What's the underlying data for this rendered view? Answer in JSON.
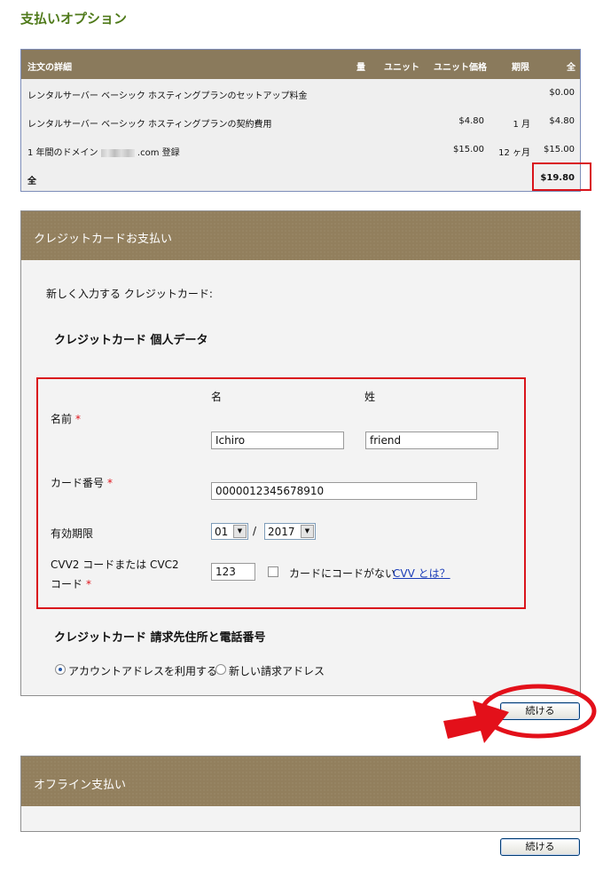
{
  "page": {
    "title": "支払いオプション"
  },
  "order": {
    "headers": {
      "details": "注文の詳細",
      "qty": "量",
      "unit": "ユニット",
      "unit_price": "ユニット価格",
      "period": "期限",
      "total": "全"
    },
    "rows": [
      {
        "desc": "レンタルサーバー ベーシック ホスティングプランのセットアップ料金",
        "unit_price": "",
        "period": "",
        "total": "$0.00"
      },
      {
        "desc": "レンタルサーバー ベーシック ホスティングプランの契約費用",
        "unit_price": "$4.80",
        "period": "1 月",
        "total": "$4.80"
      },
      {
        "desc_prefix": "1 年間のドメイン",
        "desc_suffix": ".com 登録",
        "unit_price": "$15.00",
        "period": "12 ヶ月",
        "total": "$15.00"
      }
    ],
    "total_row": {
      "label": "全",
      "value": "$19.80"
    }
  },
  "credit_card": {
    "header": "クレジットカードお支払い",
    "new_card_text": "新しく入力する クレジットカード:",
    "personal_section": "クレジットカード 個人データ",
    "first_name_label": "名",
    "last_name_label": "姓",
    "name_label": "名前",
    "first_name_value": "Ichiro",
    "last_name_value": "friend",
    "card_number_label": "カード番号",
    "card_number_value": "0000012345678910",
    "expiry_label": "有効期限",
    "expiry_month": "01",
    "expiry_sep": "/",
    "expiry_year": "2017",
    "cvv_label_1": "CVV2 コードまたは CVC2",
    "cvv_label_2": "コード",
    "cvv_value": "123",
    "no_code_label": "カードにコードがない",
    "cvv_link": "CVV とは？",
    "required_mark": "*",
    "billing_section": "クレジットカード 請求先住所と電話番号",
    "radio_account": "アカウントアドレスを利用する",
    "radio_new": "新しい請求アドレス",
    "continue_label": "続ける"
  },
  "offline": {
    "header": "オフライン支払い",
    "continue_label": "続ける"
  },
  "colors": {
    "accent_red": "#d9141b",
    "header_brown": "#927f5d",
    "title_green": "#4f7a1a",
    "link_blue": "#1a3cb8"
  }
}
